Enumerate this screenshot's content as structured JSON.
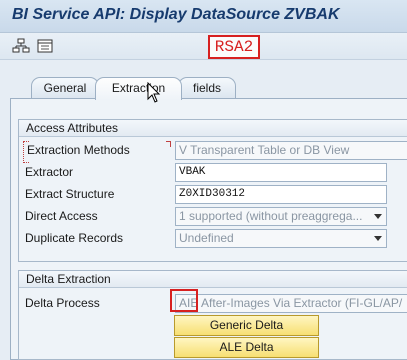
{
  "window": {
    "title": "BI Service API: Display DataSource ZVBAK"
  },
  "toolbar": {
    "icons": [
      "hierarchy-icon",
      "display-object-icon"
    ],
    "annotation": "RSA2"
  },
  "tabs": [
    {
      "label": "General",
      "active": false
    },
    {
      "label": "Extraction",
      "active": true
    },
    {
      "label": "fields",
      "active": false
    }
  ],
  "access_attributes": {
    "title": "Access Attributes",
    "rows": [
      {
        "label": "Extraction Methods",
        "value": "V Transparent Table or DB View"
      },
      {
        "label": "Extractor",
        "value": "VBAK"
      },
      {
        "label": "Extract Structure",
        "value": "Z0XID30312"
      },
      {
        "label": "Direct Access",
        "value": "1 supported (without preaggrega..."
      },
      {
        "label": "Duplicate Records",
        "value": "Undefined"
      }
    ]
  },
  "delta_extraction": {
    "title": "Delta Extraction",
    "delta_process_label": "Delta Process",
    "delta_process_code": "AIE",
    "delta_process_text": "After-Images Via Extractor (FI-GL/AP/",
    "generic_delta_button": "Generic Delta",
    "ale_delta_button": "ALE Delta"
  },
  "colors": {
    "annotation_red": "#d72020",
    "button_yellow": "#f7df73",
    "title_blue": "#173b6e"
  }
}
